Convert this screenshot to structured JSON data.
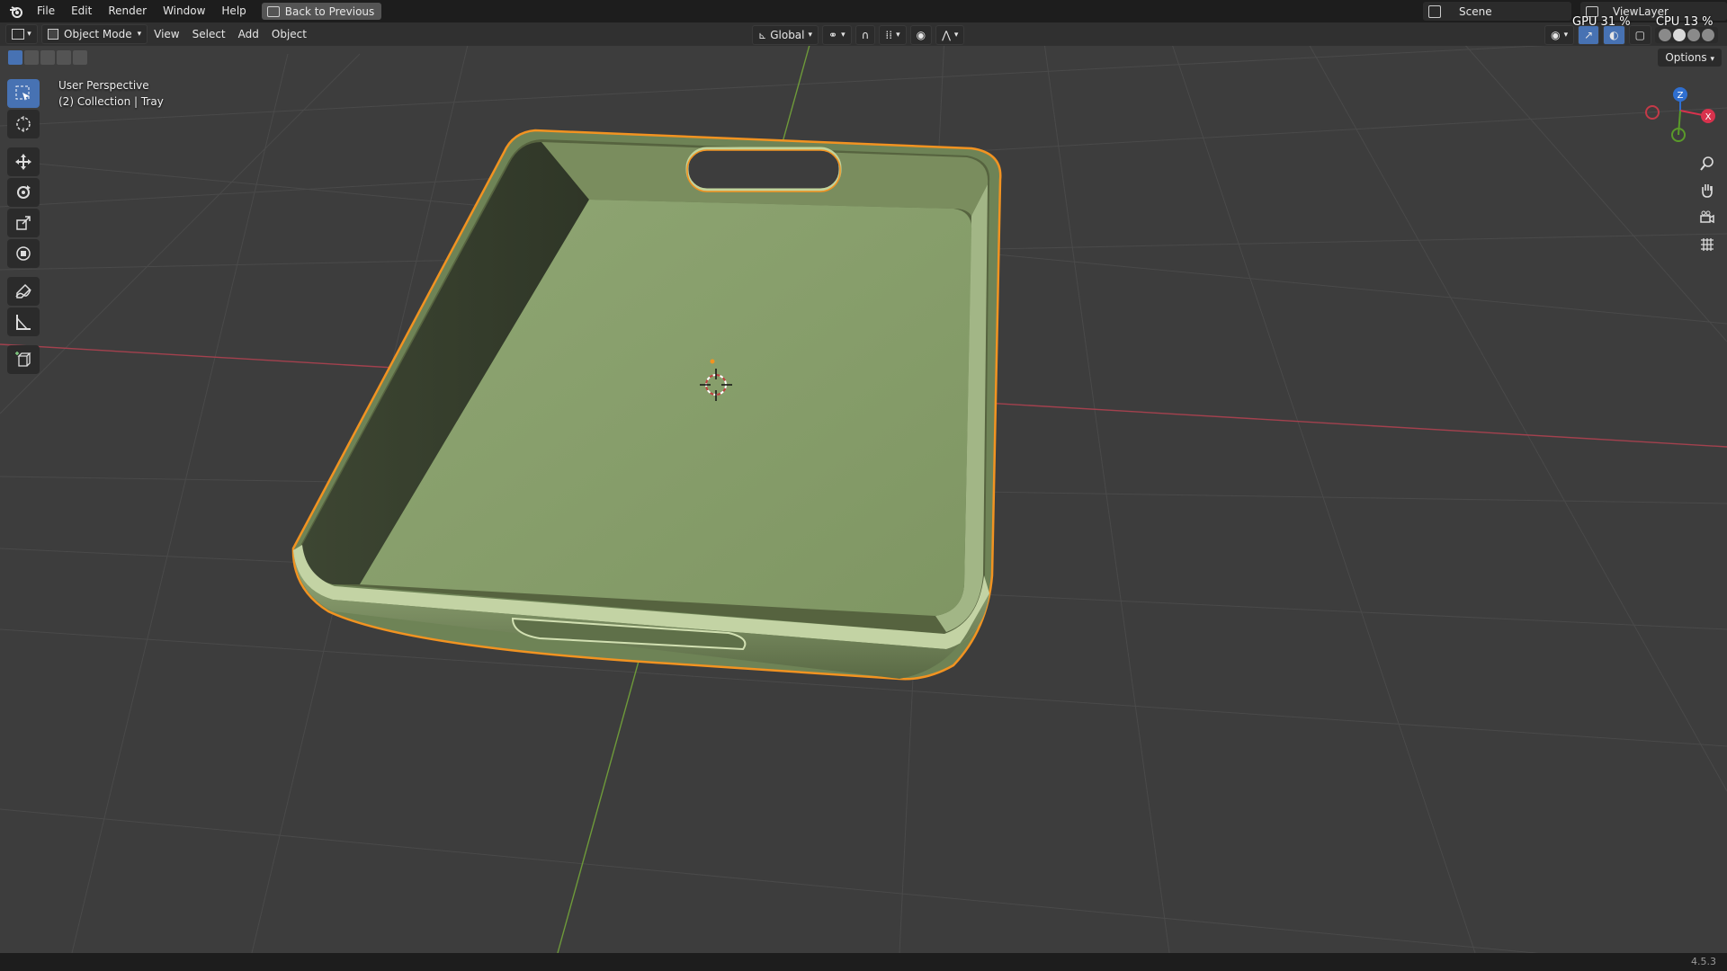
{
  "app": {
    "name": "Blender",
    "version": "4.5.3"
  },
  "menu": {
    "items": [
      "File",
      "Edit",
      "Render",
      "Window",
      "Help"
    ],
    "back_button": "Back to Previous"
  },
  "scene": {
    "label": "Scene"
  },
  "view_layer": {
    "label": "ViewLayer"
  },
  "stats": {
    "gpu": "GPU 31 %",
    "cpu": "CPU 13 %"
  },
  "header": {
    "mode": "Object Mode",
    "menus": [
      "View",
      "Select",
      "Add",
      "Object"
    ],
    "transform_orientation": "Global"
  },
  "options": {
    "label": "Options"
  },
  "viewport": {
    "perspective": "User Perspective",
    "collection": "(2) Collection | Tray"
  },
  "gizmo": {
    "z": "Z",
    "x": "X"
  },
  "toolbar": {
    "tools": [
      "select-box",
      "cursor",
      "move",
      "rotate",
      "scale",
      "transform",
      "annotate",
      "measure",
      "add-cube"
    ],
    "active": "select-box"
  },
  "colors": {
    "accent": "#4772b3",
    "selection": "#f29321",
    "tray": "#8ea36f",
    "axis_x": "#a3414e",
    "axis_y": "#6e9a3a"
  }
}
